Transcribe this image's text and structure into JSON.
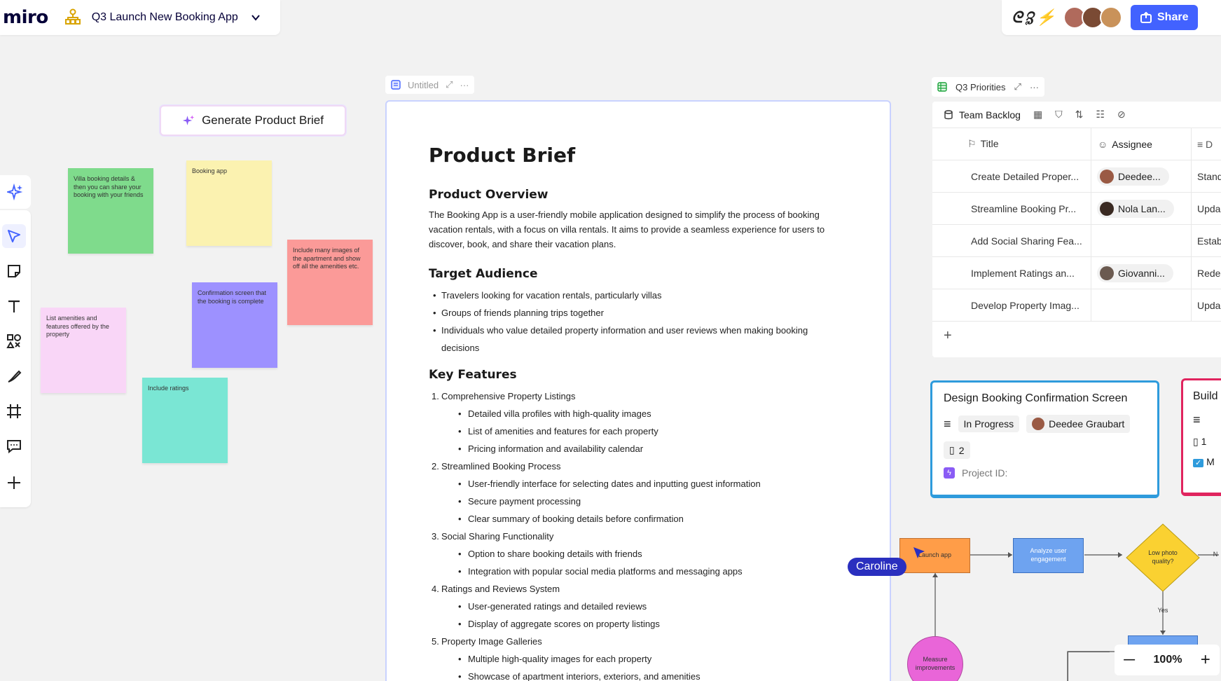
{
  "app": {
    "logo": "miro",
    "board_title": "Q3 Launch New Booking App"
  },
  "header_right": {
    "share_label": "Share"
  },
  "canvas": {
    "generate_button": "Generate Product Brief",
    "stickies": [
      {
        "text": "Villa booking details & then you can share your booking with your friends",
        "color": "#7fdb8c"
      },
      {
        "text": "Booking app",
        "color": "#fbf2b0"
      },
      {
        "text": "Include many images of the apartment and show off all the amenities etc.",
        "color": "#fb9a98"
      },
      {
        "text": "Confirmation screen that the booking is complete",
        "color": "#9d91ff"
      },
      {
        "text": "List amenities and features offered by the property",
        "color": "#f9d6f7"
      },
      {
        "text": "Include ratings",
        "color": "#7ae6d4"
      }
    ]
  },
  "doc": {
    "header_title": "Untitled",
    "title": "Product Brief",
    "overview_heading": "Product Overview",
    "overview_text": "The Booking App is a user-friendly mobile application designed to simplify the process of booking vacation rentals, with a focus on villa rentals. It aims to provide a seamless experience for users to discover, book, and share their vacation plans.",
    "audience_heading": "Target Audience",
    "audience": [
      "Travelers looking for vacation rentals, particularly villas",
      "Groups of friends planning trips together",
      "Individuals who value detailed property information and user reviews when making booking decisions"
    ],
    "features_heading": "Key Features",
    "features": [
      {
        "num": "1.",
        "title": "Comprehensive Property Listings",
        "items": [
          "Detailed villa profiles with high-quality images",
          "List of amenities and features for each property",
          "Pricing information and availability calendar"
        ]
      },
      {
        "num": "2.",
        "title": "Streamlined Booking Process",
        "items": [
          "User-friendly interface for selecting dates and inputting guest information",
          "Secure payment processing",
          "Clear summary of booking details before confirmation"
        ]
      },
      {
        "num": "3.",
        "title": "Social Sharing Functionality",
        "items": [
          "Option to share booking details with friends",
          "Integration with popular social media platforms and messaging apps"
        ]
      },
      {
        "num": "4.",
        "title": "Ratings and Reviews System",
        "items": [
          "User-generated ratings and detailed reviews",
          "Display of aggregate scores on property listings"
        ]
      },
      {
        "num": "5.",
        "title": "Property Image Galleries",
        "items": [
          "Multiple high-quality images for each property",
          "Showcase of apartment interiors, exteriors, and amenities"
        ]
      }
    ]
  },
  "table": {
    "header_title": "Q3 Priorities",
    "view_name": "Team Backlog",
    "col_title": "Title",
    "col_assignee": "Assignee",
    "add_label": "+",
    "rows": [
      {
        "title": "Create Detailed Proper...",
        "assignee": "Deedee...",
        "desc": "Stand"
      },
      {
        "title": "Streamline Booking Pr...",
        "assignee": "Nola Lan...",
        "desc": "Upda"
      },
      {
        "title": "Add Social Sharing Fea...",
        "assignee": "",
        "desc": "Estab"
      },
      {
        "title": "Implement Ratings an...",
        "assignee": "Giovanni...",
        "desc": "Rede"
      },
      {
        "title": "Develop Property Imag...",
        "assignee": "",
        "desc": "Upda"
      }
    ]
  },
  "card": {
    "title": "Design Booking Confirmation Screen",
    "status": "In Progress",
    "assignee": "Deedee Graubart",
    "count": "2",
    "project_label": "Project ID:"
  },
  "card2": {
    "title": "Build",
    "count": "1",
    "tag": "M"
  },
  "flow": {
    "launch": "Launch app",
    "analyze": "Analyze user engagement",
    "decision": "Low photo quality?",
    "yes": "Yes",
    "no": "N",
    "measure": "Measure improvements"
  },
  "cursor_user": "Caroline",
  "zoom": {
    "level": "100%",
    "minus": "—",
    "plus": "+"
  }
}
